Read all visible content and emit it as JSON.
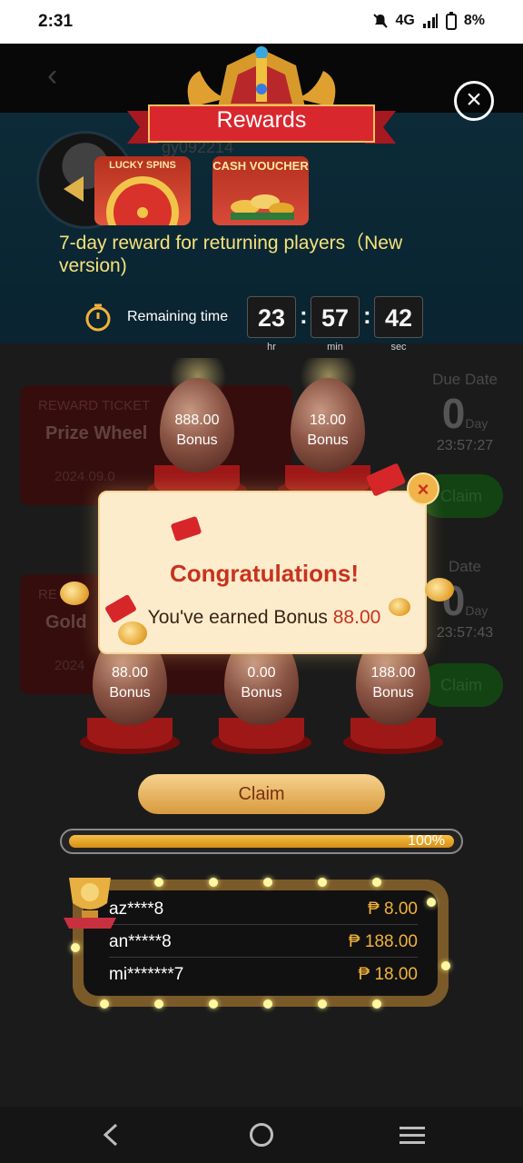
{
  "status_bar": {
    "time": "2:31",
    "network": "4G",
    "battery": "8%"
  },
  "background_page": {
    "username": "gy092214",
    "tickets": [
      {
        "type_label": "REWARD TICKET",
        "name": "Prize Wheel",
        "date": "2024.09.0"
      },
      {
        "type_label": "RE",
        "name": "Gold",
        "date": "2024"
      }
    ],
    "due": [
      {
        "label": "Due Date",
        "days": "0",
        "unit": "Day",
        "time": "23:57:27",
        "button": "Claim"
      },
      {
        "label": "Date",
        "days": "0",
        "unit": "Day",
        "time": "23:57:43",
        "button": "Claim"
      }
    ]
  },
  "rewards": {
    "title": "Rewards",
    "tiles": [
      {
        "label": "LUCKY SPINS"
      },
      {
        "label": "CASH VOUCHER"
      }
    ],
    "promo_text": "7-day reward for returning players（New version)",
    "timer": {
      "label": "Remaining time",
      "hours": "23",
      "minutes": "57",
      "seconds": "42",
      "hours_unit": "hr",
      "minutes_unit": "min",
      "seconds_unit": "sec"
    },
    "eggs_top": [
      {
        "value": "888.00",
        "label": "Bonus"
      },
      {
        "value": "18.00",
        "label": "Bonus"
      }
    ],
    "eggs_bottom": [
      {
        "value": "88.00",
        "label": "Bonus"
      },
      {
        "value": "0.00",
        "label": "Bonus"
      },
      {
        "value": "188.00",
        "label": "Bonus"
      }
    ],
    "claim_label": "Claim",
    "progress": {
      "value": 100,
      "label": "100%"
    },
    "winners": [
      {
        "name": "az****8",
        "amount": "₱ 8.00"
      },
      {
        "name": "an*****8",
        "amount": "₱ 188.00"
      },
      {
        "name": "mi*******7",
        "amount": "₱ 18.00"
      }
    ]
  },
  "congrats_dialog": {
    "title": "Congratulations!",
    "message_prefix": "You've earned Bonus ",
    "amount": "88.00",
    "close": "×"
  },
  "colors": {
    "accent_gold": "#f2b23a",
    "congrats_red": "#c8321e",
    "ribbon_red": "#d8282e"
  }
}
